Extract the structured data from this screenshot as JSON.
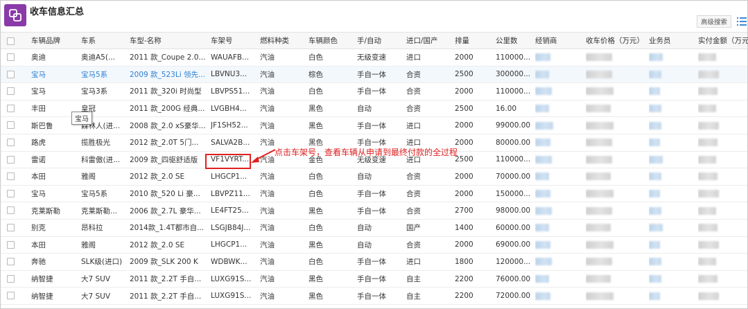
{
  "window": {
    "title": "收车信息汇总",
    "advanced_search_label": "高级搜索",
    "app_icon": "link-icon",
    "list_icon": "list-icon"
  },
  "table": {
    "columns": [
      "车辆品牌",
      "车系",
      "车型-名称",
      "车架号",
      "燃料种类",
      "车辆颜色",
      "手/自动",
      "进口/国产",
      "排量",
      "公里数",
      "经销商",
      "收车价格（万元）",
      "业务员",
      "实付金额（万元"
    ],
    "rows": [
      [
        "奥迪",
        "奥迪A5(...",
        "2011 款_Coupe 2.0...",
        "WAUAFB...",
        "汽油",
        "白色",
        "无级变速",
        "进口",
        "2000",
        "110000..."
      ],
      [
        "宝马",
        "宝马5系",
        "2009 款_523Li 领先...",
        "LBVNU3...",
        "汽油",
        "棕色",
        "手自一体",
        "合资",
        "2500",
        "300000..."
      ],
      [
        "宝马",
        "宝马3系",
        "2011 款_320i 时尚型",
        "LBVPS51...",
        "汽油",
        "白色",
        "手自一体",
        "合资",
        "2000",
        "110000..."
      ],
      [
        "丰田",
        "皇冠",
        "2011 款_200G 经典...",
        "LVGBH4...",
        "汽油",
        "黑色",
        "自动",
        "合资",
        "2500",
        "16.00"
      ],
      [
        "斯巴鲁",
        "森林人(进...",
        "2008 款_2.0 xS豪华...",
        "JF1SH52...",
        "汽油",
        "黑色",
        "手自一体",
        "进口",
        "2000",
        "99000.00"
      ],
      [
        "路虎",
        "揽胜极光",
        "2012 款_2.0T 5门...",
        "SALVA2B...",
        "汽油",
        "黑色",
        "手自一体",
        "进口",
        "2000",
        "80000.00"
      ],
      [
        "雷诺",
        "科雷傲(进...",
        "2009 款_四驱舒适版",
        "VF1VYRT...",
        "汽油",
        "金色",
        "无级变速",
        "进口",
        "2500",
        "110000..."
      ],
      [
        "本田",
        "雅阁",
        "2012 款_2.0 SE",
        "LHGCP1...",
        "汽油",
        "白色",
        "自动",
        "合资",
        "2000",
        "70000.00"
      ],
      [
        "宝马",
        "宝马5系",
        "2010 款_520 Li 豪...",
        "LBVPZ11...",
        "汽油",
        "白色",
        "手自一体",
        "合资",
        "2000",
        "150000..."
      ],
      [
        "克莱斯勒",
        "克莱斯勒...",
        "2006 款_2.7L 豪华...",
        "LE4FT25...",
        "汽油",
        "黑色",
        "手自一体",
        "合资",
        "2700",
        "98000.00"
      ],
      [
        "别克",
        "昂科拉",
        "2014款_1.4T都市自...",
        "LSGJB84J...",
        "汽油",
        "白色",
        "自动",
        "国产",
        "1400",
        "60000.00"
      ],
      [
        "本田",
        "雅阁",
        "2012 款_2.0 SE",
        "LHGCP1...",
        "汽油",
        "黑色",
        "自动",
        "合资",
        "2000",
        "69000.00"
      ],
      [
        "奔驰",
        "SLK级(进口)",
        "2009 款_SLK 200 K",
        "WDBWK...",
        "汽油",
        "白色",
        "手自一体",
        "进口",
        "1800",
        "120000..."
      ],
      [
        "纳智捷",
        "大7 SUV",
        "2011 款_2.2T 手自...",
        "LUXG91S...",
        "汽油",
        "黑色",
        "手自一体",
        "自主",
        "2200",
        "76000.00"
      ],
      [
        "纳智捷",
        "大7 SUV",
        "2011 款_2.2T 手自...",
        "LUXG91S...",
        "汽油",
        "黑色",
        "手自一体",
        "自主",
        "2200",
        "72000.00"
      ]
    ]
  },
  "tooltip": "宝马",
  "annotation": "点击车架号，查看车辆从申请到最终付款的全过程",
  "colors": {
    "accent_purple": "#8a3aa8",
    "link_blue": "#2b7fd0",
    "annotation_red": "#e02020"
  }
}
